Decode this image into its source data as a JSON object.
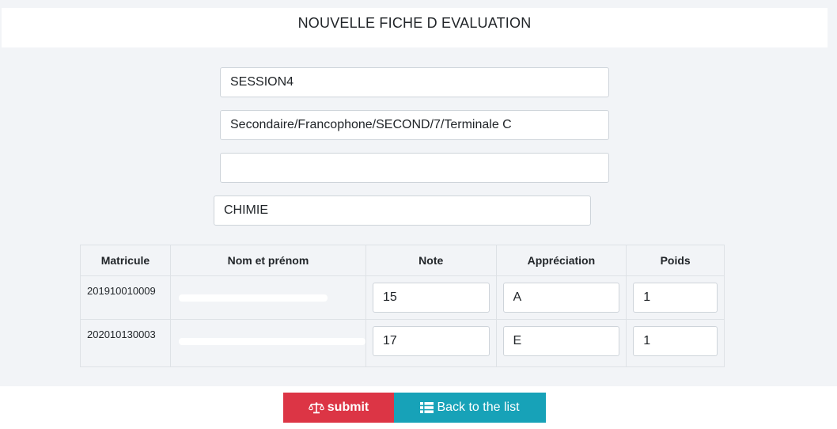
{
  "header": {
    "title": "NOUVELLE FICHE D EVALUATION"
  },
  "form": {
    "session": "SESSION4",
    "classe": "Secondaire/Francophone/SECOND/7/Terminale C",
    "empty_field": "",
    "matiere": "CHIMIE"
  },
  "table": {
    "headers": [
      "Matricule",
      "Nom et prénom",
      "Note",
      "Appréciation",
      "Poids"
    ],
    "rows": [
      {
        "matricule": "201910010009",
        "note": "15",
        "appreciation": "A",
        "poids": "1"
      },
      {
        "matricule": "202010130003",
        "note": "17",
        "appreciation": "E",
        "poids": "1"
      }
    ]
  },
  "buttons": {
    "submit_label": "submit",
    "back_label": "Back to the list"
  },
  "icons": {
    "submit": "balance-scale-icon",
    "back": "list-icon"
  },
  "colors": {
    "submit": "#dc3545",
    "back": "#17a2b8",
    "panel": "#f2f4f7"
  }
}
